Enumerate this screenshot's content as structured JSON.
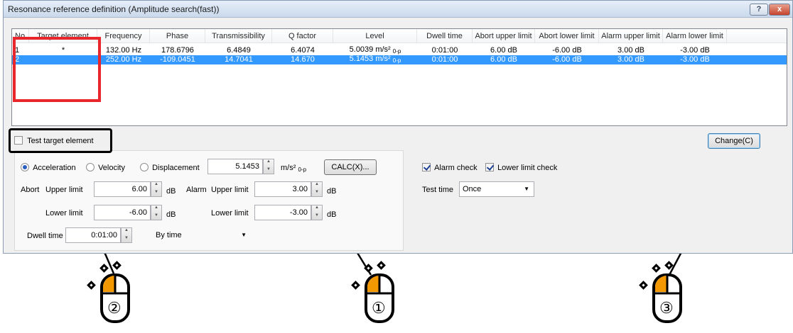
{
  "window": {
    "title": "Resonance reference definition (Amplitude search(fast))",
    "help": "?",
    "close": "x"
  },
  "table": {
    "columns": [
      "No.",
      "Target element",
      "Frequency",
      "Phase",
      "Transmissibility",
      "Q factor",
      "Level",
      "Dwell time",
      "Abort upper limit",
      "Abort lower limit",
      "Alarm upper limit",
      "Alarm lower limit"
    ],
    "rows": [
      {
        "no": "1",
        "target": "*",
        "frequency": "132.00 Hz",
        "phase": "178.6796",
        "transmissibility": "6.4849",
        "q_factor": "6.4074",
        "level": "5.0039 m/s²",
        "level_sub": "0-p",
        "dwell": "0:01:00",
        "abort_upper": "6.00 dB",
        "abort_lower": "-6.00 dB",
        "alarm_upper": "3.00 dB",
        "alarm_lower": "-3.00 dB"
      },
      {
        "no": "2",
        "target": "",
        "frequency": "252.00 Hz",
        "phase": "-109.0451",
        "transmissibility": "14.7041",
        "q_factor": "14.670",
        "level": "5.1453 m/s²",
        "level_sub": "0-p",
        "dwell": "0:01:00",
        "abort_upper": "6.00 dB",
        "abort_lower": "-6.00 dB",
        "alarm_upper": "3.00 dB",
        "alarm_lower": "-3.00 dB"
      }
    ]
  },
  "test_target": {
    "label": "Test target element",
    "checked": false
  },
  "change_button": "Change(C)",
  "mode": {
    "options": [
      "Acceleration",
      "Velocity",
      "Displacement"
    ],
    "selected": "Acceleration"
  },
  "level": {
    "value": "5.1453",
    "unit": "m/s²",
    "unit_sub": "0-p",
    "calc_button": "CALC(X)..."
  },
  "abort": {
    "label": "Abort",
    "upper_label": "Upper limit",
    "upper": "6.00",
    "lower_label": "Lower limit",
    "lower": "-6.00",
    "unit": "dB"
  },
  "alarm": {
    "label": "Alarm",
    "upper_label": "Upper limit",
    "upper": "3.00",
    "lower_label": "Lower limit",
    "lower": "-3.00",
    "unit": "dB"
  },
  "dwell": {
    "label": "Dwell time",
    "value": "0:01:00",
    "mode": "By time"
  },
  "alarm_check": {
    "label": "Alarm check",
    "checked": true
  },
  "lower_limit_check": {
    "label": "Lower limit check",
    "checked": true
  },
  "test_time": {
    "label": "Test time",
    "value": "Once"
  },
  "markers": [
    "②",
    "①",
    "③"
  ],
  "colors": {
    "selection": "#3399ff",
    "callout_red": "#e8262b",
    "mouse_button": "#f39800"
  }
}
